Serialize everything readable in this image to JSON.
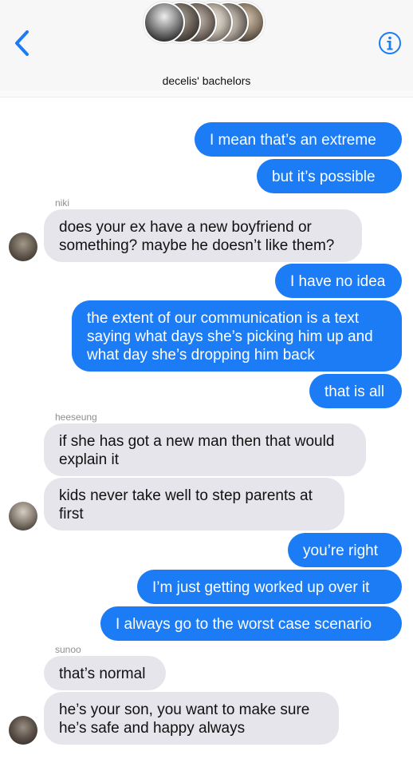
{
  "header": {
    "group_name": "decelis' bachelors",
    "back_icon": "chevron-left-icon",
    "info_icon": "info-icon",
    "accent": "#1b7cf5"
  },
  "messages": [
    {
      "side": "out",
      "text": "I mean that’s an extreme"
    },
    {
      "side": "out",
      "text": "but it’s possible"
    },
    {
      "side": "sender",
      "text": "niki"
    },
    {
      "side": "in",
      "text": "does your ex have a new boyfriend or\nsomething? maybe he doesn’t like them?"
    },
    {
      "side": "out",
      "text": "I have no idea"
    },
    {
      "side": "out",
      "text": "the extent of our communication is a text\nsaying what days she’s picking him up and\nwhat day she’s dropping him back"
    },
    {
      "side": "out",
      "text": "that is all"
    },
    {
      "side": "sender",
      "text": "heeseung"
    },
    {
      "side": "in",
      "text": "if she has got a new man then that would\nexplain it"
    },
    {
      "side": "in",
      "text": "kids never take well to step parents at\nfirst"
    },
    {
      "side": "out",
      "text": "you’re right"
    },
    {
      "side": "out",
      "text": "I’m just getting worked up over it"
    },
    {
      "side": "out",
      "text": "I always go to the worst case scenario"
    },
    {
      "side": "sender",
      "text": "sunoo"
    },
    {
      "side": "in",
      "text": "that’s normal"
    },
    {
      "side": "in",
      "text": "he’s your son, you want to make sure\nhe’s safe and happy always"
    }
  ],
  "colors": {
    "outgoing_bubble": "#1b7cf5",
    "incoming_bubble": "#e6e5eb"
  }
}
